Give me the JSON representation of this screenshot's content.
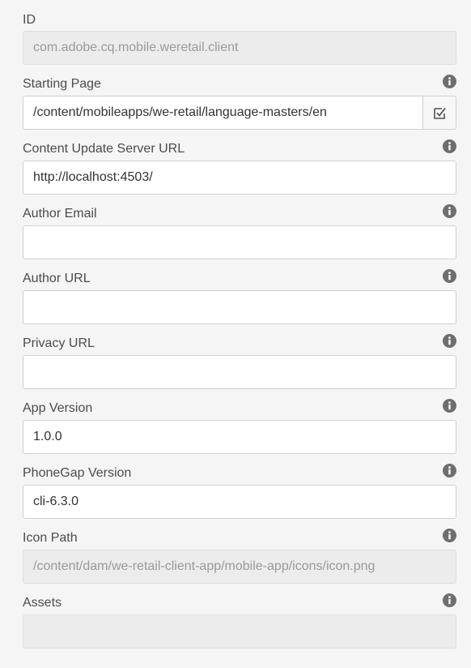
{
  "form": {
    "id_field": {
      "label": "ID",
      "value": "com.adobe.cq.mobile.weretail.client"
    },
    "starting_page": {
      "label": "Starting Page",
      "value": "/content/mobileapps/we-retail/language-masters/en",
      "browse_icon": "checkbox-picker-icon"
    },
    "content_update_server_url": {
      "label": "Content Update Server URL",
      "value": "http://localhost:4503/"
    },
    "author_email": {
      "label": "Author Email",
      "value": ""
    },
    "author_url": {
      "label": "Author URL",
      "value": ""
    },
    "privacy_url": {
      "label": "Privacy URL",
      "value": ""
    },
    "app_version": {
      "label": "App Version",
      "value": "1.0.0"
    },
    "phonegap_version": {
      "label": "PhoneGap Version",
      "value": "cli-6.3.0"
    },
    "icon_path": {
      "label": "Icon Path",
      "value": "/content/dam/we-retail-client-app/mobile-app/icons/icon.png"
    },
    "assets": {
      "label": "Assets",
      "value": ""
    }
  },
  "icons": {
    "info": "info-icon"
  },
  "colors": {
    "background": "#f5f5f5",
    "label_text": "#4b4b4b",
    "input_border": "#d0d0d0",
    "readonly_fill": "#ececec",
    "readonly_text": "#9a9a9a",
    "info_icon": "#6e6e6e"
  }
}
